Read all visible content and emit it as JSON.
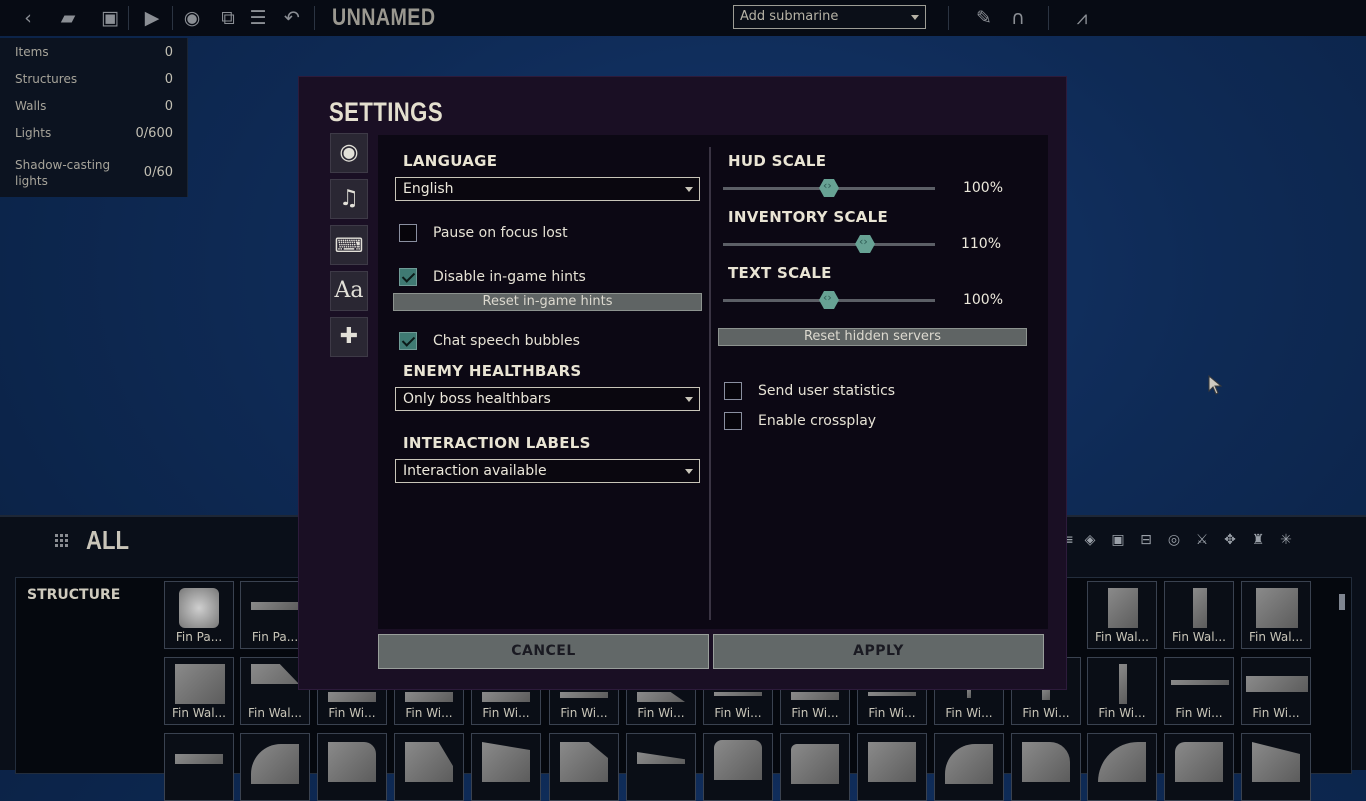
{
  "toolbar": {
    "submarine_name": "UNNAMED",
    "add_submarine": "Add submarine",
    "icons": [
      "back-icon",
      "open-folder-icon",
      "save-icon",
      "play-icon",
      "visibility-icon",
      "copy-icon",
      "layers-icon",
      "undo-icon",
      "pencil-icon",
      "wiring-icon",
      "graph-icon"
    ]
  },
  "stats": {
    "rows": [
      {
        "label": "Items",
        "value": "0"
      },
      {
        "label": "Structures",
        "value": "0"
      },
      {
        "label": "Walls",
        "value": "0"
      },
      {
        "label": "Lights",
        "value": "0/600"
      },
      {
        "label": "Shadow-casting lights",
        "value": "0/60"
      }
    ]
  },
  "settings": {
    "title": "SETTINGS",
    "tabs": [
      "graphics-tab",
      "audio-tab",
      "controls-tab",
      "gameplay-tab",
      "mods-tab"
    ],
    "language": {
      "label": "LANGUAGE",
      "value": "English"
    },
    "pause_on_focus_lost": {
      "label": "Pause on focus lost",
      "checked": false
    },
    "disable_hints": {
      "label": "Disable in-game hints",
      "checked": true
    },
    "reset_hints": "Reset in-game hints",
    "chat_bubbles": {
      "label": "Chat speech bubbles",
      "checked": true
    },
    "enemy_healthbars": {
      "label": "ENEMY HEALTHBARS",
      "value": "Only boss healthbars"
    },
    "interaction_labels": {
      "label": "INTERACTION LABELS",
      "value": "Interaction available"
    },
    "hud_scale": {
      "label": "HUD SCALE",
      "value": "100%",
      "level": 0.5
    },
    "inventory_scale": {
      "label": "INVENTORY SCALE",
      "value": "110%",
      "level": 0.67
    },
    "text_scale": {
      "label": "TEXT SCALE",
      "value": "100%",
      "level": 0.5
    },
    "reset_servers": "Reset hidden servers",
    "send_stats": {
      "label": "Send user statistics",
      "checked": false
    },
    "crossplay": {
      "label": "Enable crossplay",
      "checked": false
    },
    "cancel": "CANCEL",
    "apply": "APPLY"
  },
  "editor": {
    "category": "ALL",
    "structure_label": "STRUCTURE",
    "row1": [
      "Fin Pa...",
      "Fin Pa...",
      "Fin Wal...",
      "Fin Wal...",
      "Fin Wal..."
    ],
    "row2": [
      "Fin Wal...",
      "Fin Wal...",
      "Fin Wi...",
      "Fin Wi...",
      "Fin Wi...",
      "Fin Wi...",
      "Fin Wi...",
      "Fin Wi...",
      "Fin Wi...",
      "Fin Wi...",
      "Fin Wi...",
      "Fin Wi...",
      "Fin Wi...",
      "Fin Wi...",
      "Fin Wi..."
    ]
  }
}
